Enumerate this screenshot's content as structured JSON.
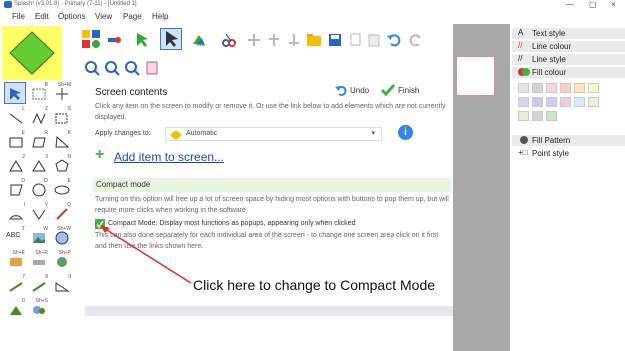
{
  "window": {
    "title": "Splash! (v3.01.8) - Primary (7-11) - [Untitled 1]",
    "minimize": "—",
    "restore": "▢",
    "close": "×"
  },
  "menu": {
    "items": [
      "File",
      "Edit",
      "Options",
      "View",
      "Page",
      "Help"
    ]
  },
  "tools": [
    {
      "key": "B"
    },
    {
      "key": "Sh+M"
    },
    {
      "key": "L"
    },
    {
      "key": "Z"
    },
    {
      "key": "S"
    },
    {
      "key": "E"
    },
    {
      "key": "R"
    },
    {
      "key": "K"
    },
    {
      "key": "2"
    },
    {
      "key": "3"
    },
    {
      "key": "N"
    },
    {
      "key": "D"
    },
    {
      "key": "O"
    },
    {
      "key": "E"
    },
    {
      "key": "I"
    },
    {
      "key": "V"
    },
    {
      "key": "Q"
    },
    {
      "key": "T",
      "label": "ABC"
    },
    {
      "key": "W"
    },
    {
      "key": "Sh+W"
    },
    {
      "key": "Sh+E"
    },
    {
      "key": "Sh+R"
    },
    {
      "key": "Sh+P"
    },
    {
      "key": "7"
    },
    {
      "key": "8"
    },
    {
      "key": "9"
    },
    {
      "key": "0"
    },
    {
      "key": "Sh+S"
    }
  ],
  "dialog": {
    "title": "Screen contents",
    "undo_label": "Undo",
    "finish_label": "Finish",
    "description": "Click any item on the screen to modify or remove it.  Or use the link below to add elements which are not currently displayed.",
    "apply_label": "Apply changes to:",
    "apply_value": "Automatic",
    "add_link": "Add item to screen...",
    "compact_heading": "Compact mode",
    "compact_desc": "Turning on this option will free up a lot of screen space by hiding most options with buttons to pop them up, but will require more clicks when working in the software.",
    "compact_checkbox_label": "Compact Mode: Display most functions as popups, appearing only when clicked",
    "compact_note": "This can also done separately for each individual area of the screen - to change one screen area click on it first and then use the links shown here."
  },
  "annotation": {
    "text": "Click here to change to Compact Mode"
  },
  "style_panel": {
    "items": [
      {
        "label": "Text style",
        "icon": "text-style-icon"
      },
      {
        "label": "Line colour",
        "icon": "line-colour-icon"
      },
      {
        "label": "Line style",
        "icon": "line-style-icon"
      },
      {
        "label": "Fill colour",
        "icon": "fill-colour-icon"
      },
      {
        "label": "Fill Pattern",
        "icon": "fill-pattern-icon"
      },
      {
        "label": "Point style",
        "icon": "point-style-icon"
      }
    ],
    "swatches": [
      "#e6e6e6",
      "#d4d4d4",
      "#ffd6d6",
      "#f7d0c0",
      "#ffe6b8",
      "#fffacd",
      "#d9d4f0",
      "#c8c8f0",
      "#d6c8f0",
      "#f0c8e6",
      "#d4ecff",
      "#dff5d6",
      "#e6f0d4",
      "#d4d4d4",
      "#c8e6c8"
    ]
  }
}
